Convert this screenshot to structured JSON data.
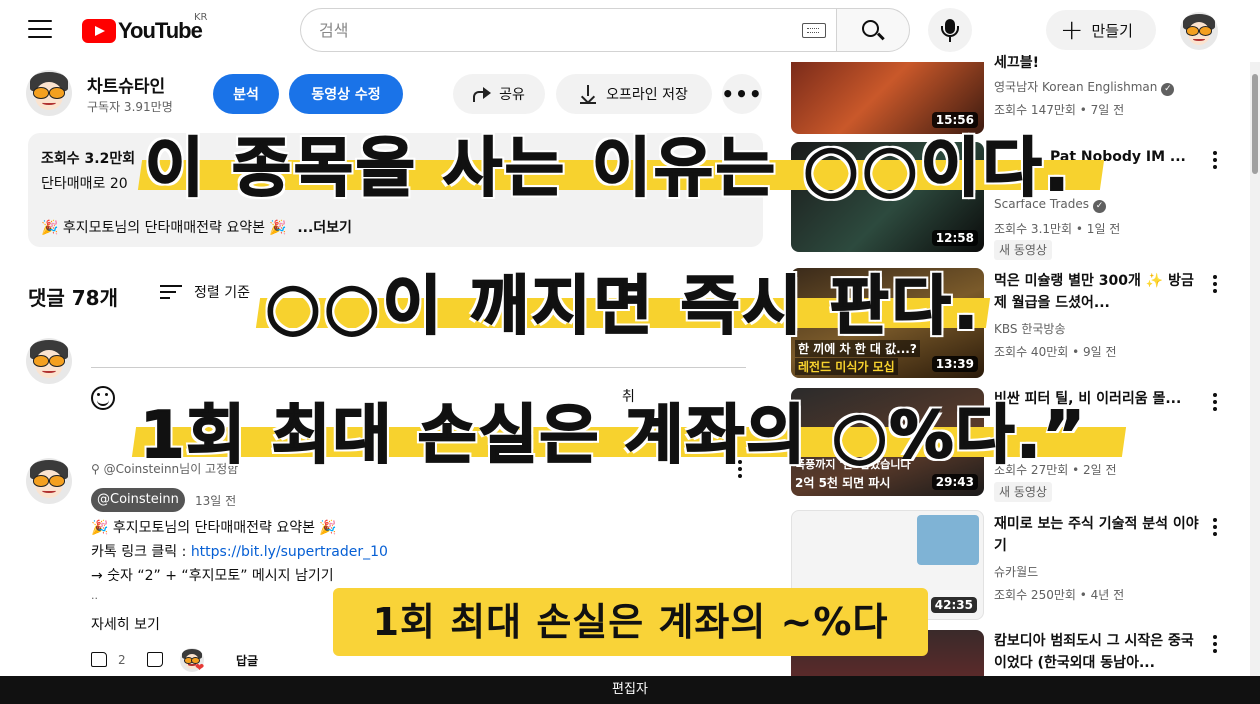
{
  "topbar": {
    "logo_text": "YouTube",
    "country_code": "KR",
    "search_placeholder": "검색",
    "create_label": "만들기"
  },
  "video": {
    "channel_name": "차트슈타인",
    "subscribers": "구독자 3.91만명",
    "analytics_label": "분석",
    "edit_label": "동영상 수정",
    "share_label": "공유",
    "offline_label": "오프라인 저장"
  },
  "description": {
    "line1": "조회수 3.2만회 ",
    "line2": "단타매매로 20",
    "line3": "🎉 후지모토님의 단타매매전략 요약본 🎉",
    "more_label": "...더보기"
  },
  "comments": {
    "count_label": "댓글 78개",
    "sort_label": "정렬 기준",
    "cancel_fragment": "취",
    "pinned_label": "@Coinsteinn님이 고정함",
    "author": "@Coinsteinn",
    "time": "13일 전",
    "lines": [
      "🎉 후지모토님의 단타매매전략 요약본 🎉",
      "카톡 링크 클릭 : ",
      "→ 숫자 “2” + “후지모토” 메시지 남기기",
      ".."
    ],
    "link": "https://bit.ly/supertrader_10",
    "read_more": "자세히 보기",
    "likes": "2",
    "reply_label": "답글"
  },
  "sidebar": {
    "videos": [
      {
        "title": "세끄블!",
        "channel": "영국남자 Korean Englishman",
        "meta": "조회수 147만회 • 7일 전",
        "duration": "15:56"
      },
      {
        "title": "Pat Nobody IM ...",
        "channel": "Scarface Trades",
        "meta": "조회수 3.1만회 • 1일 전",
        "badge": "새 동영상",
        "duration": "12:58"
      },
      {
        "title": "먹은 미슐랭 별만 300개 ✨ 방금 제 월급을 드셨어...",
        "channel": "KBS 한국방송",
        "meta": "조회수 40만회 • 9일 전",
        "duration": "13:39"
      },
      {
        "title": "비싼 피터 틸, 비 이러리움 몰...",
        "channel": "",
        "meta": "조회수 27만회 • 2일 전",
        "badge": "새 동영상",
        "duration": "29:43"
      },
      {
        "title": "재미로 보는 주식 기술적 분석 이야기",
        "channel": "슈카월드",
        "meta": "조회수 250만회 • 4년 전",
        "duration": "42:35"
      },
      {
        "title": "캄보디아 범죄도시 그 시작은 중국이었다 (한국외대 동남아...",
        "channel": "",
        "meta": "",
        "duration": ""
      }
    ],
    "thumb_texts": {
      "t3_line1": "한 끼에 차 한 대 값...?",
      "t3_line2": "레전드 미식가 모십",
      "t4_line1": "폭풍까지 '한' 남았습니다",
      "t4_line2": "2억 5천 되면 파시"
    }
  },
  "overlays": {
    "line1": "이 종목을 사는 이유는 ○○이다.",
    "line2": "○○이 깨지면 즉시 판다.",
    "line3": "1회 최대 손실은 계좌의 ○%다.”",
    "caption": "1회 최대 손실은 계좌의 ~%다"
  },
  "footer": {
    "label": "편집자"
  }
}
